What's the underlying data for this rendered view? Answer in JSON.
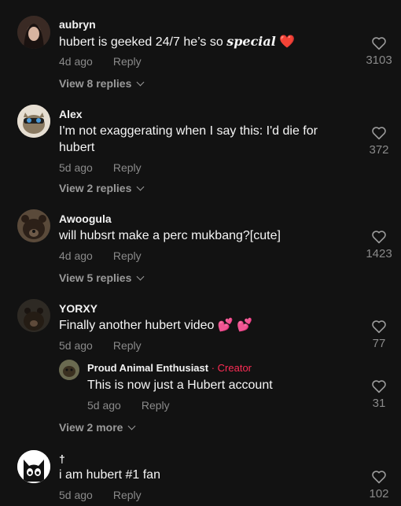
{
  "comments": [
    {
      "username": "aubryn",
      "text": "hubert is geeked 24/7 he’s so ",
      "text_special": "special",
      "emoji": "❤️",
      "time": "4d ago",
      "reply_label": "Reply",
      "likes": "3103",
      "view_replies": "View 8 replies"
    },
    {
      "username": "Alex",
      "text_line1": "I'm not exaggerating when I say this: I'd die for",
      "text_line2": "hubert",
      "time": "5d ago",
      "reply_label": "Reply",
      "likes": "372",
      "view_replies": "View 2 replies"
    },
    {
      "username": "Awoogula",
      "text": "will hubsrt make a perc mukbang?[cute]",
      "time": "4d ago",
      "reply_label": "Reply",
      "likes": "1423",
      "view_replies": "View 5 replies"
    },
    {
      "username": "YORXY",
      "text": "Finally another hubert video",
      "emoji": "💕 💕",
      "time": "5d ago",
      "reply_label": "Reply",
      "likes": "77",
      "reply": {
        "username": "Proud Animal Enthusiast",
        "creator_badge": "· Creator",
        "text": "This is now just a Hubert account",
        "time": "5d ago",
        "reply_label": "Reply",
        "likes": "31"
      },
      "view_more": "View 2 more"
    },
    {
      "username": "†",
      "text": "i am hubert #1 fan",
      "time": "5d ago",
      "reply_label": "Reply",
      "likes": "102"
    }
  ],
  "colors": {
    "background": "#121212",
    "creator": "#fe2c55",
    "emoji_heart": "#fe2c55"
  }
}
